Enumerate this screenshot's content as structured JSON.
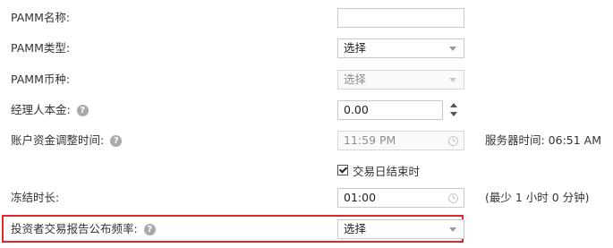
{
  "fields": {
    "pamm_name": {
      "label": "PAMM名称:",
      "value": ""
    },
    "pamm_type": {
      "label": "PAMM类型:",
      "value": "选择"
    },
    "pamm_currency": {
      "label": "PAMM币种:",
      "value": "选择"
    },
    "manager_capital": {
      "label": "经理人本金:",
      "value": "0.00"
    },
    "balance_adjust_time": {
      "label": "账户资金调整时间:",
      "value": "11:59 PM",
      "server_time_label": "服务器时间: 06:51 AM",
      "checkbox_label": "交易日结束时",
      "checkbox_checked": true
    },
    "freeze_duration": {
      "label": "冻结时长:",
      "value": "01:00",
      "hint": "(最少 1 小时 0 分钟)"
    },
    "report_frequency": {
      "label": "投资者交易报告公布频率:",
      "value": "选择"
    }
  },
  "icons": {
    "help": "?"
  },
  "colors": {
    "highlight_border": "#e2262a",
    "help_icon": "#a9a9a9"
  }
}
